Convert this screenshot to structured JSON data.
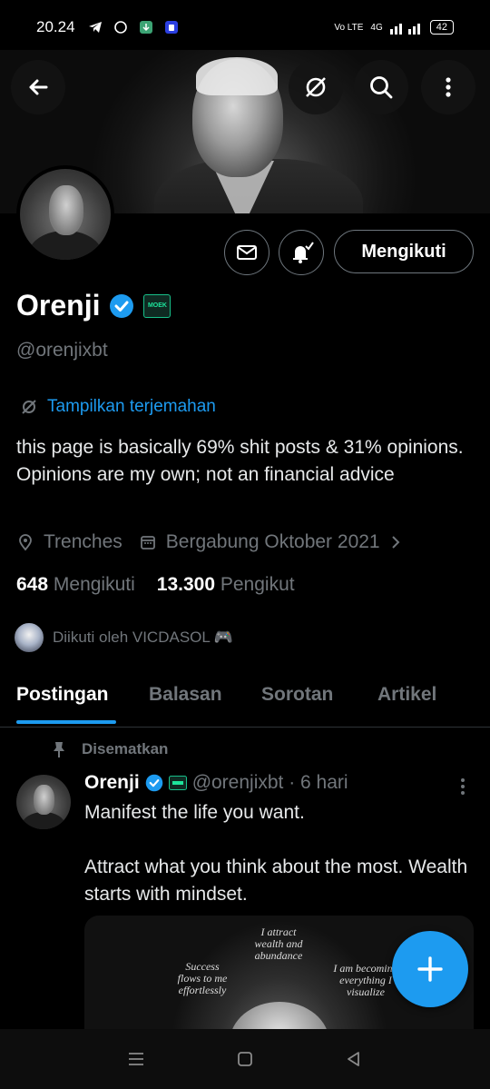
{
  "status_bar": {
    "time": "20.24",
    "network": "4G",
    "volte": "Vo LTE",
    "battery": "42"
  },
  "profile": {
    "name": "Orenji",
    "badge_text": "MOEK",
    "handle": "@orenjixbt",
    "follow_button": "Mengikuti",
    "translate_label": "Tampilkan terjemahan",
    "bio": "this page is basically 69% shit posts & 31% opinions. Opinions are my own; not an financial advice",
    "location": "Trenches",
    "joined": "Bergabung Oktober 2021",
    "following_count": "648",
    "following_label": "Mengikuti",
    "followers_count": "13.300",
    "followers_label": "Pengikut",
    "followed_by": "Diikuti oleh VICDASOL 🎮"
  },
  "tabs": [
    "Postingan",
    "Balasan",
    "Sorotan",
    "Artikel"
  ],
  "post": {
    "pinned_label": "Disematkan",
    "author": "Orenji",
    "handle_time": "@orenjixbt · 6 hari",
    "text_line1": "Manifest the life you want.",
    "text_line2": "Attract what you think about the most. Wealth starts with mindset.",
    "image_texts": {
      "left": "Success flows to me effortlessly",
      "center": "I attract wealth and abundance",
      "right": "I am becoming everything I visualize"
    }
  },
  "colors": {
    "accent": "#1d9bf0",
    "muted": "#71767b",
    "background": "#000000"
  }
}
